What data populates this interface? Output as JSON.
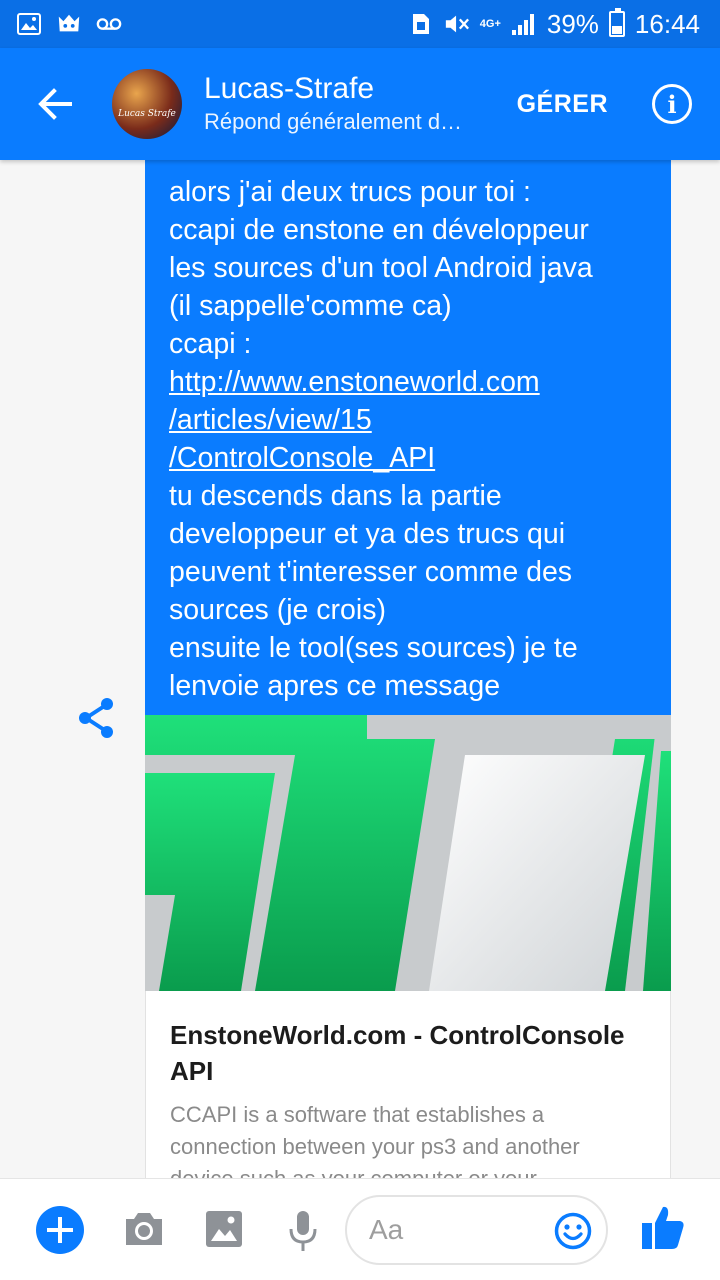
{
  "status_bar": {
    "network": "4G+",
    "battery": "39%",
    "battery_level": 0.39,
    "time": "16:44"
  },
  "header": {
    "contact_name": "Lucas-Strafe",
    "subtitle": "Répond généralement d…",
    "avatar_text": "Lucas Strafe",
    "manage_label": "GÉRER",
    "info_icon": "info-icon",
    "back_icon": "arrow-left-icon"
  },
  "message": {
    "lines": [
      "alors j'ai deux trucs pour toi :",
      "ccapi de enstone en développeur",
      "les sources d'un tool Android java",
      "(il sappelle'comme ca)",
      "ccapi :"
    ],
    "link_lines": [
      "http://www.enstoneworld.com",
      "/articles/view/15",
      "/ControlConsole_API"
    ],
    "tail_lines": [
      "tu descends dans la partie",
      "developpeur et ya des trucs qui",
      "peuvent t'interesser comme des",
      "sources (je crois)",
      "ensuite le tool(ses sources) je te",
      "lenvoie apres ce message"
    ]
  },
  "link_preview": {
    "title": "EnstoneWorld.com - ControlConsole API",
    "description": "CCAPI is a software that establishes a connection between your ps3 and another device such as your computer or your"
  },
  "composer": {
    "placeholder": "Aa"
  },
  "colors": {
    "accent": "#0a7cff",
    "status_bar": "#0a6fe6",
    "preview_green": "#17d36b"
  }
}
